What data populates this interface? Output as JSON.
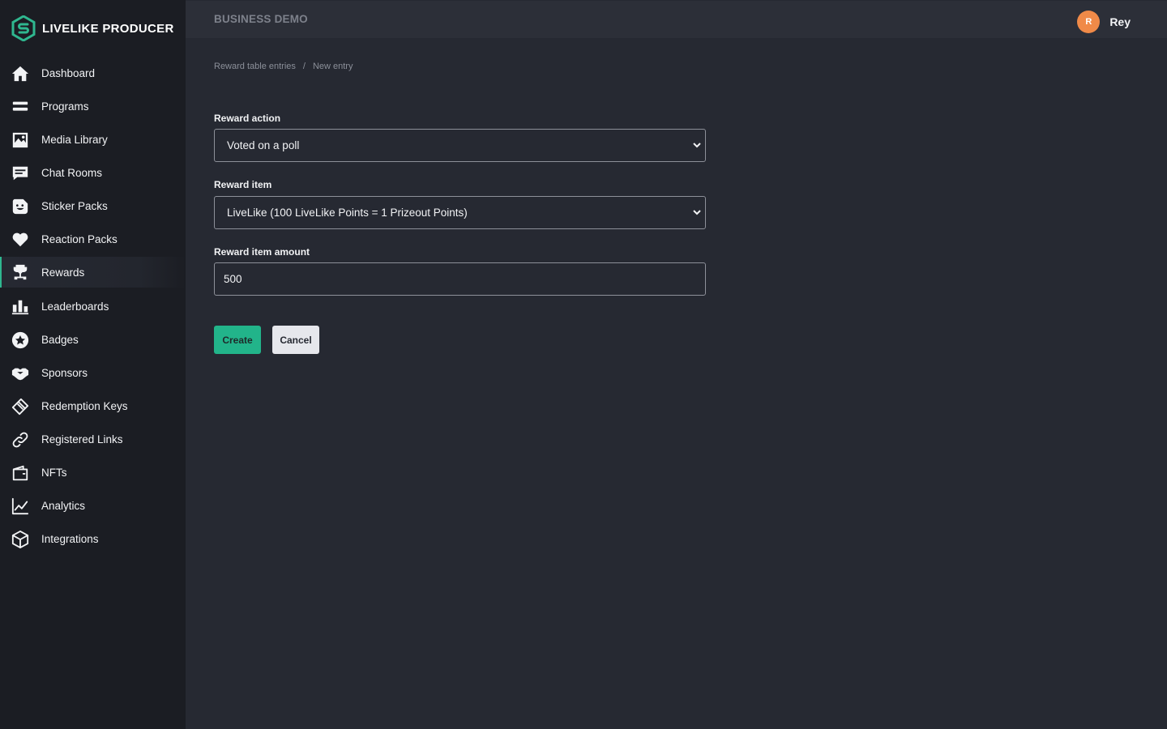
{
  "brand": {
    "name": "LIVELIKE PRODUCER",
    "accent_color": "#2fb78f"
  },
  "header": {
    "org_name": "BUSINESS DEMO",
    "user": {
      "initial": "R",
      "name": "Rey",
      "avatar_color": "#f08a48"
    }
  },
  "sidebar": {
    "items": [
      {
        "label": "Dashboard",
        "icon": "home-icon"
      },
      {
        "label": "Programs",
        "icon": "programs-icon"
      },
      {
        "label": "Media Library",
        "icon": "image-icon"
      },
      {
        "label": "Chat Rooms",
        "icon": "chat-icon"
      },
      {
        "label": "Sticker Packs",
        "icon": "sticker-icon"
      },
      {
        "label": "Reaction Packs",
        "icon": "heart-icon"
      },
      {
        "label": "Rewards",
        "icon": "rewards-icon",
        "active": true
      },
      {
        "label": "Leaderboards",
        "icon": "leaderboard-icon"
      },
      {
        "label": "Badges",
        "icon": "badge-icon"
      },
      {
        "label": "Sponsors",
        "icon": "handshake-icon"
      },
      {
        "label": "Redemption Keys",
        "icon": "ticket-icon"
      },
      {
        "label": "Registered Links",
        "icon": "link-icon"
      },
      {
        "label": "NFTs",
        "icon": "wallet-icon"
      },
      {
        "label": "Analytics",
        "icon": "chart-icon"
      },
      {
        "label": "Integrations",
        "icon": "cube-icon"
      }
    ]
  },
  "breadcrumb": {
    "parent": "Reward table entries",
    "separator": "/",
    "current": "New entry"
  },
  "form": {
    "reward_action": {
      "label": "Reward action",
      "value": "Voted on a poll"
    },
    "reward_item": {
      "label": "Reward item",
      "value": "LiveLike (100 LiveLike Points = 1 Prizeout Points)"
    },
    "reward_item_amount": {
      "label": "Reward item amount",
      "value": "500"
    },
    "create_label": "Create",
    "cancel_label": "Cancel"
  }
}
